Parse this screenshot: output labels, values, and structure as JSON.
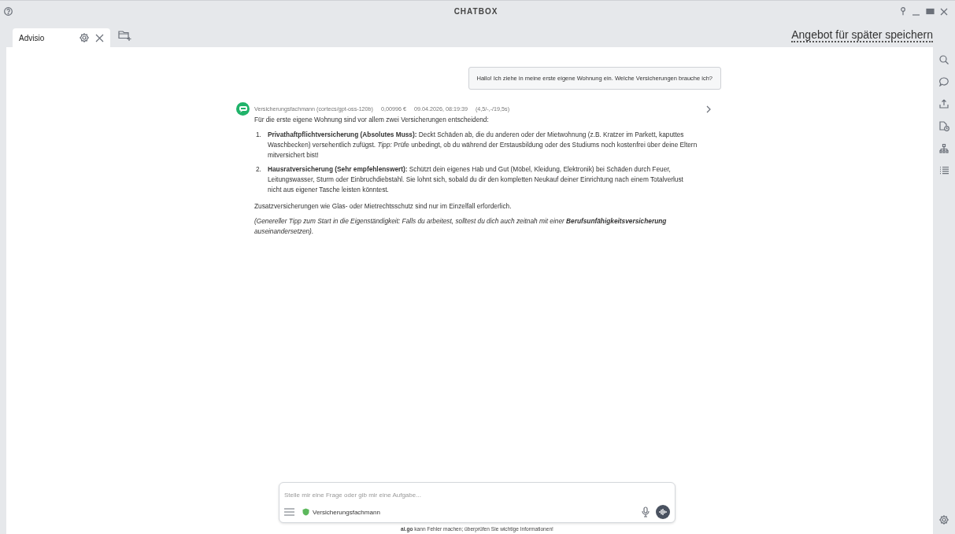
{
  "window": {
    "title": "CHATBOX"
  },
  "tabs": [
    {
      "label": "Advisio",
      "selected": true
    }
  ],
  "save_link": "Angebot für später speichern",
  "messages": [
    {
      "kind": "user",
      "text": "Hallo! Ich ziehe in meine erste eigene Wohnung ein. Welche Versicherungen brauche ich?"
    },
    {
      "kind": "assistant",
      "meta": [
        "Versicherungsfachmann (cortecs/gpt-oss-120b)",
        "0,00996 €",
        "09.04.2026, 08:19:39",
        "(4,5/-,-/19,5s)"
      ],
      "blocks": [
        {
          "kind": "para",
          "text": "Für die erste eigene Wohnung sind vor allem zwei Versicherungen entscheidend:"
        },
        {
          "kind": "list",
          "items": [
            {
              "num": "1.",
              "text": "**Privathaftpflichtversicherung (Absolutes Muss):** Deckt Schäden ab, die du anderen oder der Mietwohnung (z.B. Kratzer im Parkett, kaputtes Waschbecken) versehentlich zufügst. *Tipp:* Prüfe unbedingt, ob du während der Erstausbildung oder des Studiums noch kostenfrei über deine Eltern mitversichert bist!"
            },
            {
              "num": "2.",
              "text": "**Hausratversicherung (Sehr empfehlenswert):** Schützt dein eigenes Hab und Gut (Möbel, Kleidung, Elektronik) bei Schäden durch Feuer, Leitungswasser, Sturm oder Einbruchdiebstahl. Sie lohnt sich, sobald du dir den kompletten Neukauf deiner Einrichtung nach einem Totalverlust nicht aus eigener Tasche leisten könntest."
            }
          ]
        },
        {
          "kind": "para",
          "text": "Zusatzversicherungen wie Glas- oder Mietrechtsschutz sind nur im Einzelfall erforderlich."
        },
        {
          "kind": "note",
          "text": "(Genereller Tipp zum Start in die Eigenständigkeit: Falls du arbeitest, solltest du dich auch zeitnah mit einer **Berufsunfähigkeitsversicherung** auseinandersetzen)."
        }
      ]
    }
  ],
  "input": {
    "placeholder": "Stelle mir eine Frage oder gib mir eine Aufgabe...",
    "agent": "Versicherungsfachmann"
  },
  "disclaimer": "**ai.go** kann Fehler machen; überprüfen Sie wichtige Informationen!"
}
